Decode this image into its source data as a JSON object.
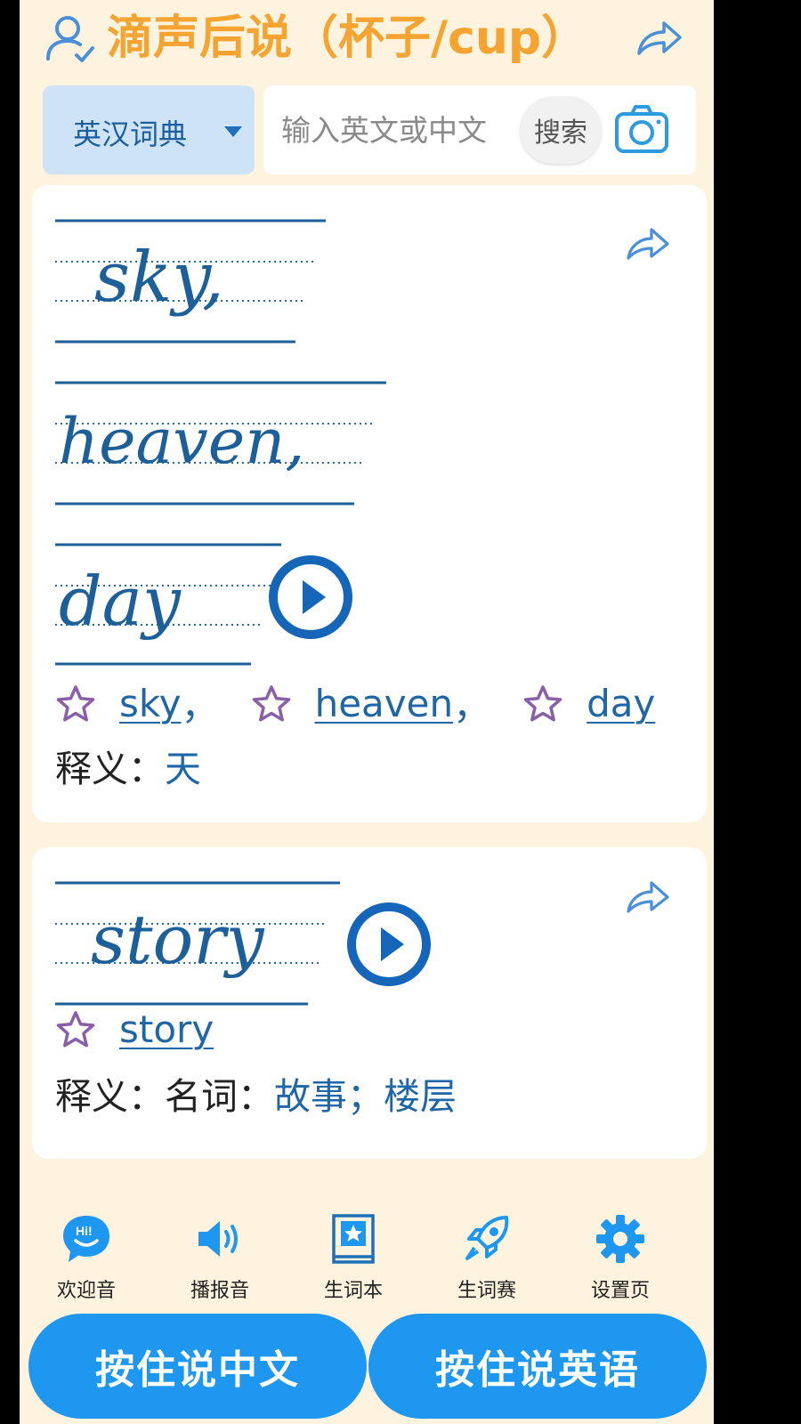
{
  "header": {
    "title": "滴声后说（杯子/cup）",
    "user_icon": "user-check-icon",
    "share_icon": "share-arrow-icon"
  },
  "search": {
    "dictionary": "英汉词典",
    "placeholder": "输入英文或中文",
    "button_label": "搜索",
    "camera_icon": "camera-icon"
  },
  "results": [
    {
      "handwriting_words": [
        "sky,",
        "heaven,",
        "day"
      ],
      "words": [
        "sky",
        "heaven",
        "day"
      ],
      "separator": "，",
      "meaning_label": "释义：",
      "meaning_value": "天"
    },
    {
      "handwriting_words": [
        "story"
      ],
      "words": [
        "story"
      ],
      "meaning_label": "释义：名词：",
      "meaning_value": "故事；楼层"
    }
  ],
  "nav": [
    {
      "label": "欢迎音",
      "icon": "hi-chat-icon"
    },
    {
      "label": "播报音",
      "icon": "speaker-icon"
    },
    {
      "label": "生词本",
      "icon": "wordbook-icon"
    },
    {
      "label": "生词赛",
      "icon": "rocket-icon"
    },
    {
      "label": "设置页",
      "icon": "gear-icon"
    }
  ],
  "voice": {
    "chinese_label": "按住说中文",
    "english_label": "按住说英语"
  },
  "colors": {
    "title": "#f5a431",
    "accent_blue": "#1e97f0",
    "ink": "#1d5f99",
    "star": "#8a5fa8",
    "background": "#fdf3de"
  }
}
